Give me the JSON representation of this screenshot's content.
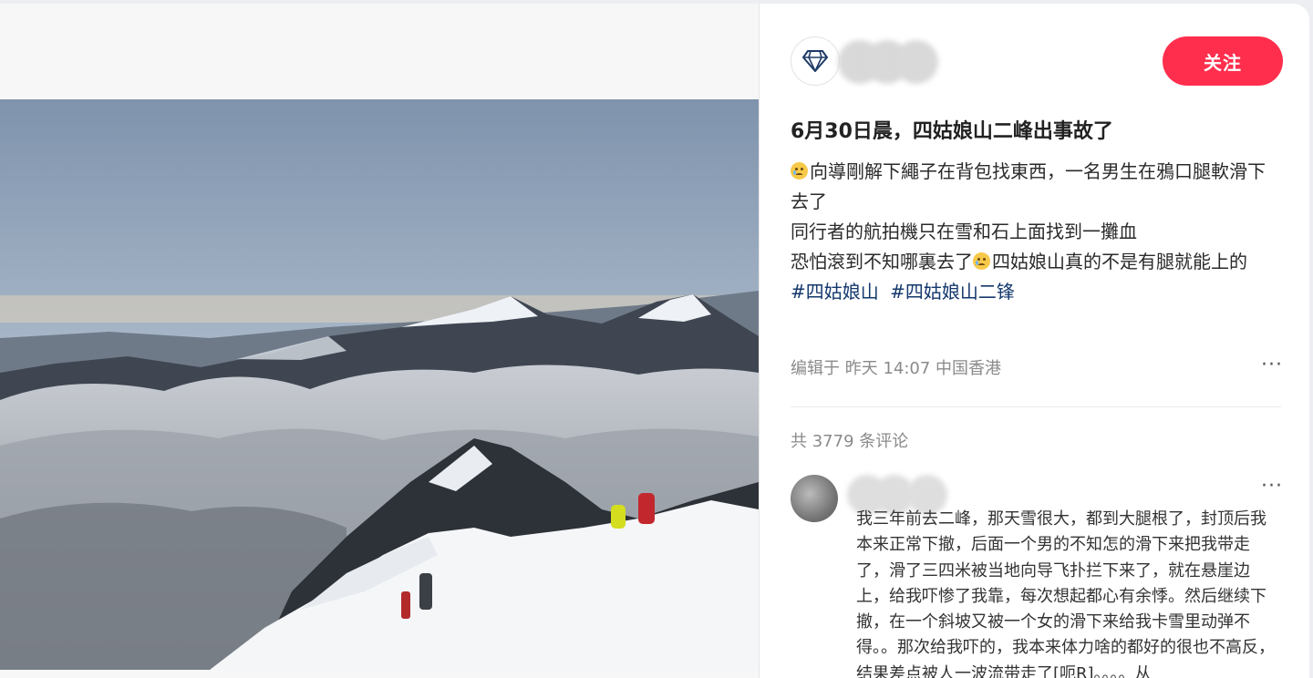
{
  "post": {
    "follow_label": "关注",
    "title": "6月30日晨，四姑娘山二峰出事故了",
    "body_lines": [
      "向導剛解下繩子在背包找東西，一名男生在鴉口腿軟滑下去了",
      "同行者的航拍機只在雪和石上面找到一攤血",
      "恐怕滾到不知哪裏去了",
      "四姑娘山真的不是有腿就能上的"
    ],
    "tags": [
      "#四姑娘山",
      "#四姑娘山二锋"
    ],
    "meta": "编辑于 昨天 14:07 中国香港",
    "more": "···"
  },
  "comments": {
    "count_label": "共 3779 条评论",
    "first": {
      "text": "我三年前去二峰，那天雪很大，都到大腿根了，封顶后我本来正常下撤，后面一个男的不知怎的滑下来把我带走了，滑了三四米被当地向导飞扑拦下来了，就在悬崖边上，给我吓惨了我靠，每次想起都心有余悸。然后继续下撤，在一个斜坡又被一个女的滑下来给我卡雪里动弹不得。。那次给我吓的，我本来体力啥的都好的很也不高反，结果差点被人一波流带走了[呃R]。。。。从",
      "more": "···"
    }
  },
  "icons": {
    "author_badge": "diamond-icon"
  },
  "colors": {
    "follow_button": "#ff2e4d",
    "tag_link": "#13386c"
  }
}
